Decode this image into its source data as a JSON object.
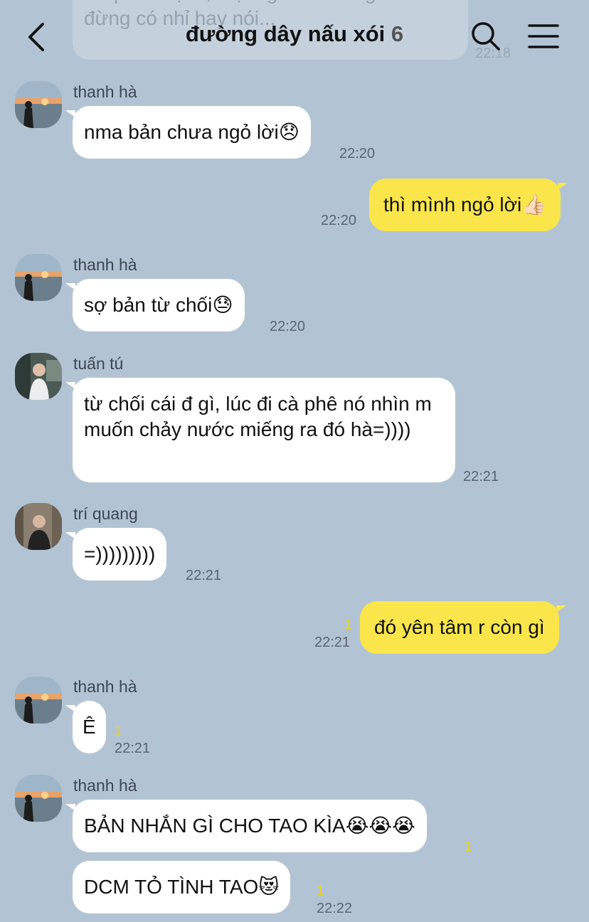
{
  "header": {
    "title": "đường dây nấu xói",
    "member_count": "6",
    "previous_message_line1": "dr quên mẹ đi, một ngta đi với ngkhác",
    "previous_message_line2": "đừng có nhỉ hay nói...",
    "previous_time": "22:18",
    "icons": {
      "back": "chevron-left-icon",
      "search": "search-icon",
      "menu": "hamburger-menu-icon"
    }
  },
  "colors": {
    "background": "#b2c4d4",
    "my_bubble": "#fae64b",
    "other_bubble": "#ffffff",
    "unread": "#e6d224"
  },
  "messages": [
    {
      "sender": "thanh hà",
      "text": "nma bản chưa ngỏ lời",
      "emoji": "😞",
      "time": "22:20"
    },
    {
      "sender": "me",
      "text": "thì mình ngỏ lời",
      "emoji": "👍🏻",
      "time": "22:20"
    },
    {
      "sender": "thanh hà",
      "text": "sợ bản từ chối",
      "emoji": "😓",
      "time": "22:20"
    },
    {
      "sender": "tuấn tú",
      "text": "từ chối cái đ gì, lúc đi cà phê nó nhìn m muốn chảy nước miếng ra đó hà=))))",
      "time": "22:21"
    },
    {
      "sender": "trí quang",
      "text": "=)))))))))",
      "time": "22:21"
    },
    {
      "sender": "me",
      "text": "đó yên tâm r còn gì",
      "unread": "1",
      "time": "22:21"
    },
    {
      "sender": "thanh hà",
      "text": "Ê",
      "unread": "1",
      "time": "22:21"
    },
    {
      "sender": "thanh hà",
      "text": "BẢN NHẮN GÌ CHO TAO KÌA",
      "emoji": "😭😭😭",
      "unread": "1"
    },
    {
      "sender": "thanh hà",
      "text": "DCM TỎ TÌNH TAO",
      "emoji": "😻",
      "unread": "1",
      "time": "22:22"
    }
  ]
}
